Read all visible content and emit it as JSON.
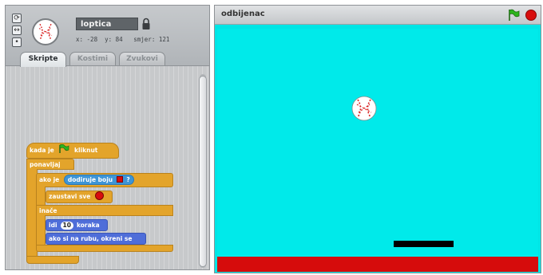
{
  "sprite": {
    "name": "loptica",
    "coords": "x: -28  y: 84   smjer: 121"
  },
  "tabs": [
    {
      "label": "Skripte",
      "active": true
    },
    {
      "label": "Kostimi",
      "active": false
    },
    {
      "label": "Zvukovi",
      "active": false
    }
  ],
  "script": {
    "hat": {
      "prefix": "kada je",
      "suffix": "kliknut"
    },
    "forever": "ponavljaj",
    "if": {
      "prefix": "ako je",
      "condition": "dodiruje boju",
      "suffix": "?"
    },
    "stop": "zaustavi sve",
    "else": "inače",
    "move": {
      "prefix": "idi",
      "value": "10",
      "suffix": "koraka"
    },
    "bounce": "ako si na rubu, okreni se"
  },
  "stage": {
    "title": "odbijenac"
  },
  "colors": {
    "stage_background": "#00e5e5",
    "floor": "#d60c0c",
    "paddle": "#000000",
    "control_block": "#e3a42b",
    "motion_block": "#4f6ed9",
    "sensing_block": "#3e95d6"
  }
}
